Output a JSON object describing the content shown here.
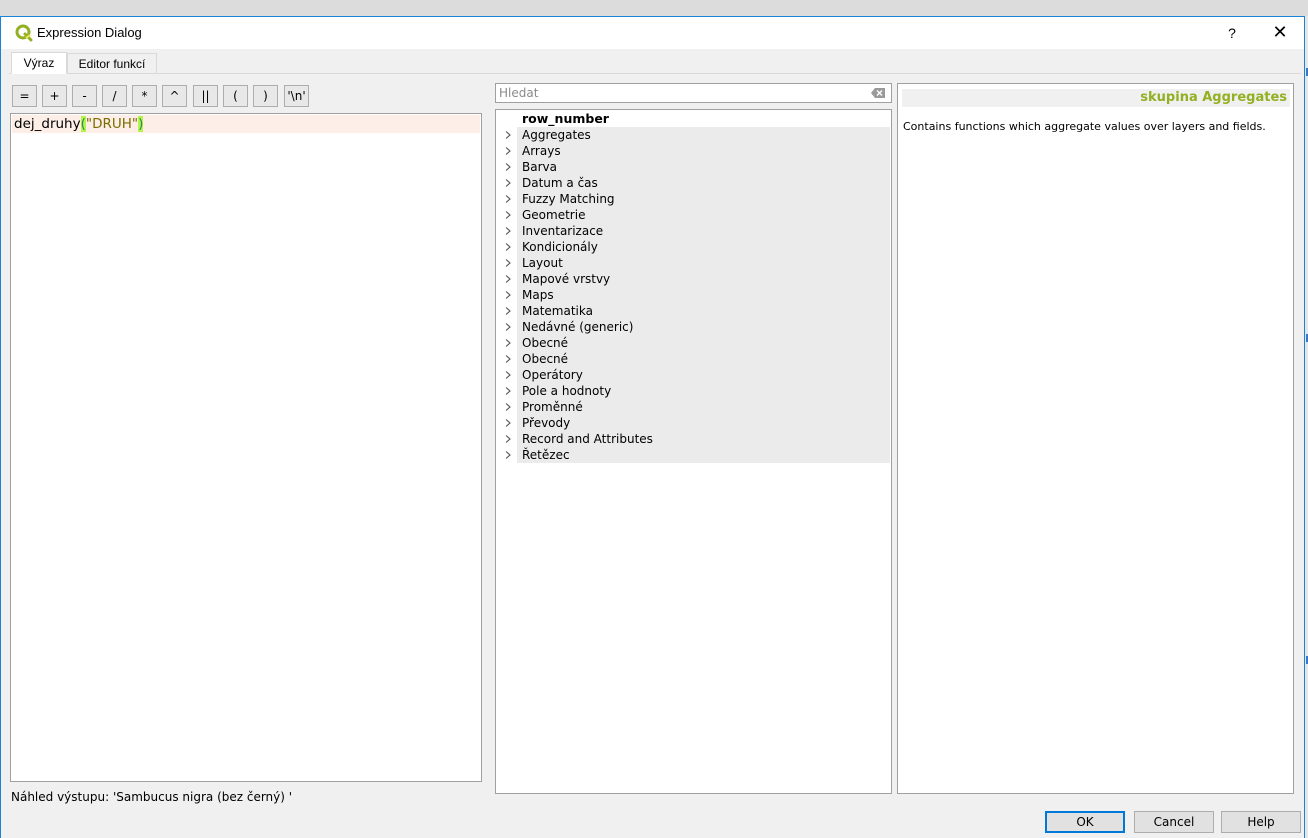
{
  "window": {
    "title": "Expression Dialog",
    "help_label": "?",
    "close_label": "✕",
    "accent": "#1883d7"
  },
  "tabs": [
    {
      "label": "Výraz",
      "active": true
    },
    {
      "label": "Editor funkcí",
      "active": false
    }
  ],
  "operators": [
    "=",
    "+",
    "-",
    "/",
    "*",
    "^",
    "||",
    "(",
    ")",
    "'\\n'"
  ],
  "editor": {
    "fn": "dej_druhy",
    "open_paren": "(",
    "arg": "\"DRUH\"",
    "close_paren": ")"
  },
  "preview": {
    "label": "Náhled výstupu:",
    "value": "'Sambucus nigra (bez černý) '"
  },
  "search": {
    "placeholder": "Hledat"
  },
  "tree": {
    "top_item": "row_number",
    "groups": [
      "Aggregates",
      "Arrays",
      "Barva",
      "Datum a čas",
      "Fuzzy Matching",
      "Geometrie",
      "Inventarizace",
      "Kondicionály",
      "Layout",
      "Mapové vrstvy",
      "Maps",
      "Matematika",
      "Nedávné (generic)",
      "Obecné",
      "Obecné",
      "Operátory",
      "Pole a hodnoty",
      "Proměnné",
      "Převody",
      "Record and Attributes",
      "Řetězec"
    ]
  },
  "help": {
    "group_title": "skupina Aggregates",
    "group_title_color": "#93b023",
    "description": "Contains functions which aggregate values over layers and fields."
  },
  "buttons": {
    "ok": "OK",
    "cancel": "Cancel",
    "help": "Help"
  }
}
